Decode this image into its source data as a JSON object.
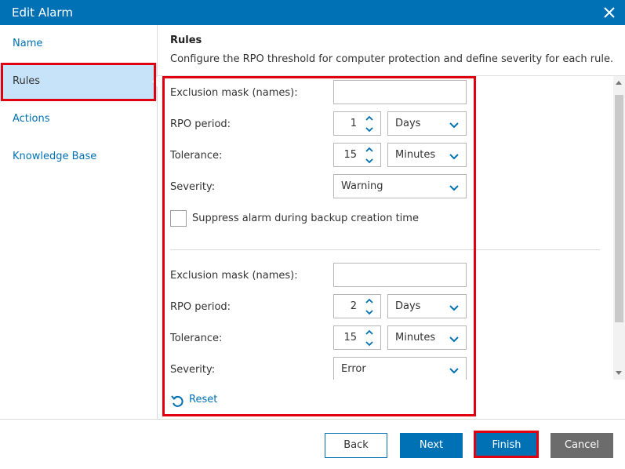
{
  "window": {
    "title": "Edit Alarm",
    "close_icon": "close-icon"
  },
  "sidebar": {
    "items": [
      {
        "label": "Name"
      },
      {
        "label": "Rules",
        "selected": true
      },
      {
        "label": "Actions"
      },
      {
        "label": "Knowledge Base"
      }
    ]
  },
  "content": {
    "title": "Rules",
    "description": "Configure the RPO threshold for computer protection and define severity for each rule."
  },
  "rules": [
    {
      "exclusion_label": "Exclusion mask (names):",
      "exclusion_value": "",
      "rpo_label": "RPO period:",
      "rpo_value": "1",
      "rpo_unit": "Days",
      "tolerance_label": "Tolerance:",
      "tolerance_value": "15",
      "tolerance_unit": "Minutes",
      "severity_label": "Severity:",
      "severity_value": "Warning",
      "suppress_label": "Suppress alarm during backup creation time",
      "suppress_checked": false
    },
    {
      "exclusion_label": "Exclusion mask (names):",
      "exclusion_value": "",
      "rpo_label": "RPO period:",
      "rpo_value": "2",
      "rpo_unit": "Days",
      "tolerance_label": "Tolerance:",
      "tolerance_value": "15",
      "tolerance_unit": "Minutes",
      "severity_label": "Severity:",
      "severity_value": "Error"
    }
  ],
  "reset_label": "Reset",
  "footer": {
    "back_label": "Back",
    "next_label": "Next",
    "finish_label": "Finish",
    "cancel_label": "Cancel"
  },
  "colors": {
    "accent": "#0071b5",
    "selected_bg": "#c6e3fa",
    "highlight": "#e1000f",
    "cancel_bg": "#6c6c6c"
  }
}
